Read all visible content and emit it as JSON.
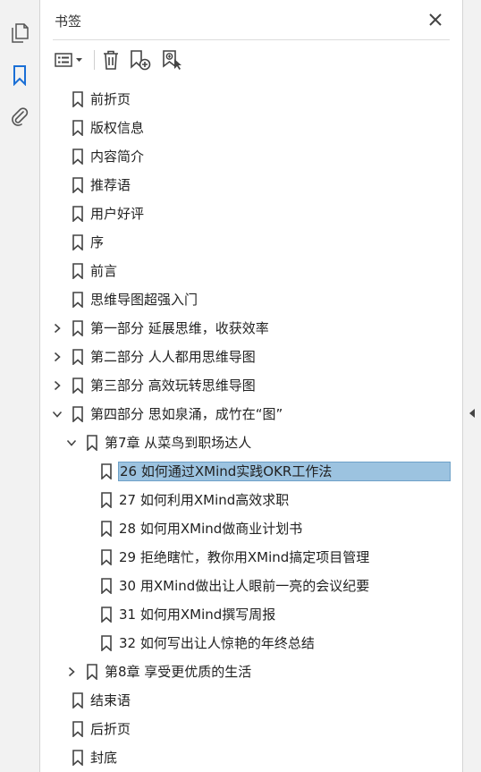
{
  "panel": {
    "title": "书签",
    "close_icon": "close-icon"
  },
  "rail": {
    "icons": [
      "pages-icon",
      "bookmark-icon",
      "attachment-icon"
    ],
    "active": "bookmark-icon",
    "accent": "#1a6fd6"
  },
  "toolbar": {
    "icons": [
      "options-menu-icon",
      "delete-bookmark-icon",
      "new-bookmark-icon",
      "new-bookmark-from-structure-icon"
    ]
  },
  "tree": {
    "items": [
      {
        "label": "前折页",
        "level": 0,
        "expander": "none"
      },
      {
        "label": "版权信息",
        "level": 0,
        "expander": "none"
      },
      {
        "label": "内容简介",
        "level": 0,
        "expander": "none"
      },
      {
        "label": "推荐语",
        "level": 0,
        "expander": "none"
      },
      {
        "label": "用户好评",
        "level": 0,
        "expander": "none"
      },
      {
        "label": "序",
        "level": 0,
        "expander": "none"
      },
      {
        "label": "前言",
        "level": 0,
        "expander": "none"
      },
      {
        "label": "思维导图超强入门",
        "level": 0,
        "expander": "none"
      },
      {
        "label": "第一部分 延展思维，收获效率",
        "level": 0,
        "expander": "collapsed"
      },
      {
        "label": "第二部分 人人都用思维导图",
        "level": 0,
        "expander": "collapsed"
      },
      {
        "label": "第三部分 高效玩转思维导图",
        "level": 0,
        "expander": "collapsed"
      },
      {
        "label": "第四部分 思如泉涌，成竹在“图”",
        "level": 0,
        "expander": "expanded"
      },
      {
        "label": "第7章 从菜鸟到职场达人",
        "level": 1,
        "expander": "expanded"
      },
      {
        "label": "26 如何通过XMind实践OKR工作法",
        "level": 2,
        "expander": "none",
        "selected": true
      },
      {
        "label": "27 如何利用XMind高效求职",
        "level": 2,
        "expander": "none"
      },
      {
        "label": "28 如何用XMind做商业计划书",
        "level": 2,
        "expander": "none"
      },
      {
        "label": "29 拒绝瞎忙，教你用XMind搞定项目管理",
        "level": 2,
        "expander": "none"
      },
      {
        "label": "30 用XMind做出让人眼前一亮的会议纪要",
        "level": 2,
        "expander": "none"
      },
      {
        "label": "31 如何用XMind撰写周报",
        "level": 2,
        "expander": "none"
      },
      {
        "label": "32 如何写出让人惊艳的年终总结",
        "level": 2,
        "expander": "none"
      },
      {
        "label": "第8章 享受更优质的生活",
        "level": 1,
        "expander": "collapsed"
      },
      {
        "label": "结束语",
        "level": 0,
        "expander": "none"
      },
      {
        "label": "后折页",
        "level": 0,
        "expander": "none"
      },
      {
        "label": "封底",
        "level": 0,
        "expander": "none"
      }
    ],
    "selection_color": "#9cc3e0"
  },
  "side_strip": {
    "icon": "collapse-panel-arrow-icon"
  }
}
